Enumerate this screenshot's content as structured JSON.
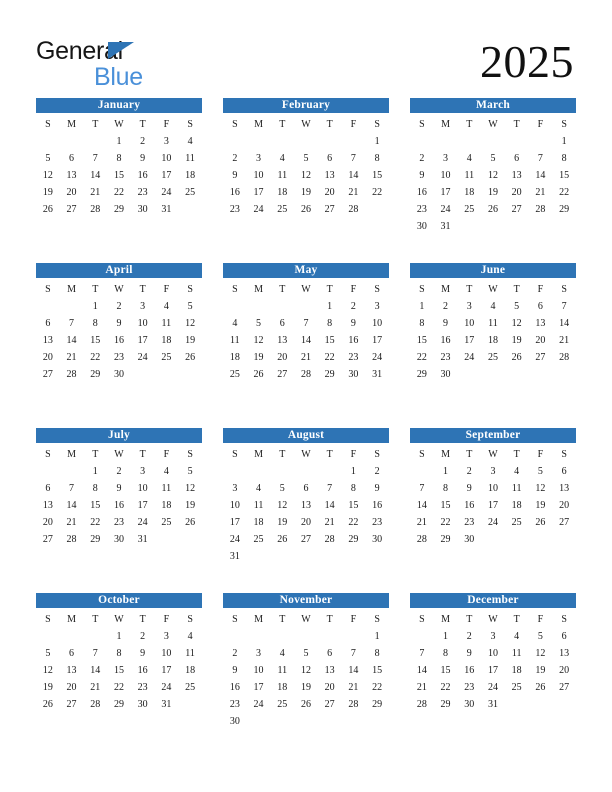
{
  "brand": {
    "name_line1": "General",
    "name_line2": "Blue",
    "triangle_icon": "triangle-icon",
    "accent_color": "#2e74b5",
    "secondary_color": "#4a90d9"
  },
  "year": "2025",
  "weekday_headers": [
    "S",
    "M",
    "T",
    "W",
    "T",
    "F",
    "S"
  ],
  "header_bar_color": "#2e74b5",
  "header_text_color": "#ffffff",
  "months": [
    {
      "name": "January",
      "first_weekday_index": 3,
      "days_in_month": 31,
      "weeks": [
        [
          "",
          "",
          "",
          "1",
          "2",
          "3",
          "4"
        ],
        [
          "5",
          "6",
          "7",
          "8",
          "9",
          "10",
          "11"
        ],
        [
          "12",
          "13",
          "14",
          "15",
          "16",
          "17",
          "18"
        ],
        [
          "19",
          "20",
          "21",
          "22",
          "23",
          "24",
          "25"
        ],
        [
          "26",
          "27",
          "28",
          "29",
          "30",
          "31",
          ""
        ],
        [
          "",
          "",
          "",
          "",
          "",
          "",
          ""
        ]
      ]
    },
    {
      "name": "February",
      "first_weekday_index": 6,
      "days_in_month": 28,
      "weeks": [
        [
          "",
          "",
          "",
          "",
          "",
          "",
          "1"
        ],
        [
          "2",
          "3",
          "4",
          "5",
          "6",
          "7",
          "8"
        ],
        [
          "9",
          "10",
          "11",
          "12",
          "13",
          "14",
          "15"
        ],
        [
          "16",
          "17",
          "18",
          "19",
          "20",
          "21",
          "22"
        ],
        [
          "23",
          "24",
          "25",
          "26",
          "27",
          "28",
          ""
        ],
        [
          "",
          "",
          "",
          "",
          "",
          "",
          ""
        ]
      ]
    },
    {
      "name": "March",
      "first_weekday_index": 6,
      "days_in_month": 31,
      "weeks": [
        [
          "",
          "",
          "",
          "",
          "",
          "",
          "1"
        ],
        [
          "2",
          "3",
          "4",
          "5",
          "6",
          "7",
          "8"
        ],
        [
          "9",
          "10",
          "11",
          "12",
          "13",
          "14",
          "15"
        ],
        [
          "16",
          "17",
          "18",
          "19",
          "20",
          "21",
          "22"
        ],
        [
          "23",
          "24",
          "25",
          "26",
          "27",
          "28",
          "29"
        ],
        [
          "30",
          "31",
          "",
          "",
          "",
          "",
          ""
        ]
      ]
    },
    {
      "name": "April",
      "first_weekday_index": 2,
      "days_in_month": 30,
      "weeks": [
        [
          "",
          "",
          "1",
          "2",
          "3",
          "4",
          "5"
        ],
        [
          "6",
          "7",
          "8",
          "9",
          "10",
          "11",
          "12"
        ],
        [
          "13",
          "14",
          "15",
          "16",
          "17",
          "18",
          "19"
        ],
        [
          "20",
          "21",
          "22",
          "23",
          "24",
          "25",
          "26"
        ],
        [
          "27",
          "28",
          "29",
          "30",
          "",
          "",
          ""
        ],
        [
          "",
          "",
          "",
          "",
          "",
          "",
          ""
        ]
      ]
    },
    {
      "name": "May",
      "first_weekday_index": 4,
      "days_in_month": 31,
      "weeks": [
        [
          "",
          "",
          "",
          "",
          "1",
          "2",
          "3"
        ],
        [
          "4",
          "5",
          "6",
          "7",
          "8",
          "9",
          "10"
        ],
        [
          "11",
          "12",
          "13",
          "14",
          "15",
          "16",
          "17"
        ],
        [
          "18",
          "19",
          "20",
          "21",
          "22",
          "23",
          "24"
        ],
        [
          "25",
          "26",
          "27",
          "28",
          "29",
          "30",
          "31"
        ],
        [
          "",
          "",
          "",
          "",
          "",
          "",
          ""
        ]
      ]
    },
    {
      "name": "June",
      "first_weekday_index": 0,
      "days_in_month": 30,
      "weeks": [
        [
          "1",
          "2",
          "3",
          "4",
          "5",
          "6",
          "7"
        ],
        [
          "8",
          "9",
          "10",
          "11",
          "12",
          "13",
          "14"
        ],
        [
          "15",
          "16",
          "17",
          "18",
          "19",
          "20",
          "21"
        ],
        [
          "22",
          "23",
          "24",
          "25",
          "26",
          "27",
          "28"
        ],
        [
          "29",
          "30",
          "",
          "",
          "",
          "",
          ""
        ],
        [
          "",
          "",
          "",
          "",
          "",
          "",
          ""
        ]
      ]
    },
    {
      "name": "July",
      "first_weekday_index": 2,
      "days_in_month": 31,
      "weeks": [
        [
          "",
          "",
          "1",
          "2",
          "3",
          "4",
          "5"
        ],
        [
          "6",
          "7",
          "8",
          "9",
          "10",
          "11",
          "12"
        ],
        [
          "13",
          "14",
          "15",
          "16",
          "17",
          "18",
          "19"
        ],
        [
          "20",
          "21",
          "22",
          "23",
          "24",
          "25",
          "26"
        ],
        [
          "27",
          "28",
          "29",
          "30",
          "31",
          "",
          ""
        ],
        [
          "",
          "",
          "",
          "",
          "",
          "",
          ""
        ]
      ]
    },
    {
      "name": "August",
      "first_weekday_index": 5,
      "days_in_month": 31,
      "weeks": [
        [
          "",
          "",
          "",
          "",
          "",
          "1",
          "2"
        ],
        [
          "3",
          "4",
          "5",
          "6",
          "7",
          "8",
          "9"
        ],
        [
          "10",
          "11",
          "12",
          "13",
          "14",
          "15",
          "16"
        ],
        [
          "17",
          "18",
          "19",
          "20",
          "21",
          "22",
          "23"
        ],
        [
          "24",
          "25",
          "26",
          "27",
          "28",
          "29",
          "30"
        ],
        [
          "31",
          "",
          "",
          "",
          "",
          "",
          ""
        ]
      ]
    },
    {
      "name": "September",
      "first_weekday_index": 1,
      "days_in_month": 30,
      "weeks": [
        [
          "",
          "1",
          "2",
          "3",
          "4",
          "5",
          "6"
        ],
        [
          "7",
          "8",
          "9",
          "10",
          "11",
          "12",
          "13"
        ],
        [
          "14",
          "15",
          "16",
          "17",
          "18",
          "19",
          "20"
        ],
        [
          "21",
          "22",
          "23",
          "24",
          "25",
          "26",
          "27"
        ],
        [
          "28",
          "29",
          "30",
          "",
          "",
          "",
          ""
        ],
        [
          "",
          "",
          "",
          "",
          "",
          "",
          ""
        ]
      ]
    },
    {
      "name": "October",
      "first_weekday_index": 3,
      "days_in_month": 31,
      "weeks": [
        [
          "",
          "",
          "",
          "1",
          "2",
          "3",
          "4"
        ],
        [
          "5",
          "6",
          "7",
          "8",
          "9",
          "10",
          "11"
        ],
        [
          "12",
          "13",
          "14",
          "15",
          "16",
          "17",
          "18"
        ],
        [
          "19",
          "20",
          "21",
          "22",
          "23",
          "24",
          "25"
        ],
        [
          "26",
          "27",
          "28",
          "29",
          "30",
          "31",
          ""
        ],
        [
          "",
          "",
          "",
          "",
          "",
          "",
          ""
        ]
      ]
    },
    {
      "name": "November",
      "first_weekday_index": 6,
      "days_in_month": 30,
      "weeks": [
        [
          "",
          "",
          "",
          "",
          "",
          "",
          "1"
        ],
        [
          "2",
          "3",
          "4",
          "5",
          "6",
          "7",
          "8"
        ],
        [
          "9",
          "10",
          "11",
          "12",
          "13",
          "14",
          "15"
        ],
        [
          "16",
          "17",
          "18",
          "19",
          "20",
          "21",
          "22"
        ],
        [
          "23",
          "24",
          "25",
          "26",
          "27",
          "28",
          "29"
        ],
        [
          "30",
          "",
          "",
          "",
          "",
          "",
          ""
        ]
      ]
    },
    {
      "name": "December",
      "first_weekday_index": 1,
      "days_in_month": 31,
      "weeks": [
        [
          "",
          "1",
          "2",
          "3",
          "4",
          "5",
          "6"
        ],
        [
          "7",
          "8",
          "9",
          "10",
          "11",
          "12",
          "13"
        ],
        [
          "14",
          "15",
          "16",
          "17",
          "18",
          "19",
          "20"
        ],
        [
          "21",
          "22",
          "23",
          "24",
          "25",
          "26",
          "27"
        ],
        [
          "28",
          "29",
          "30",
          "31",
          "",
          "",
          ""
        ],
        [
          "",
          "",
          "",
          "",
          "",
          "",
          ""
        ]
      ]
    }
  ]
}
